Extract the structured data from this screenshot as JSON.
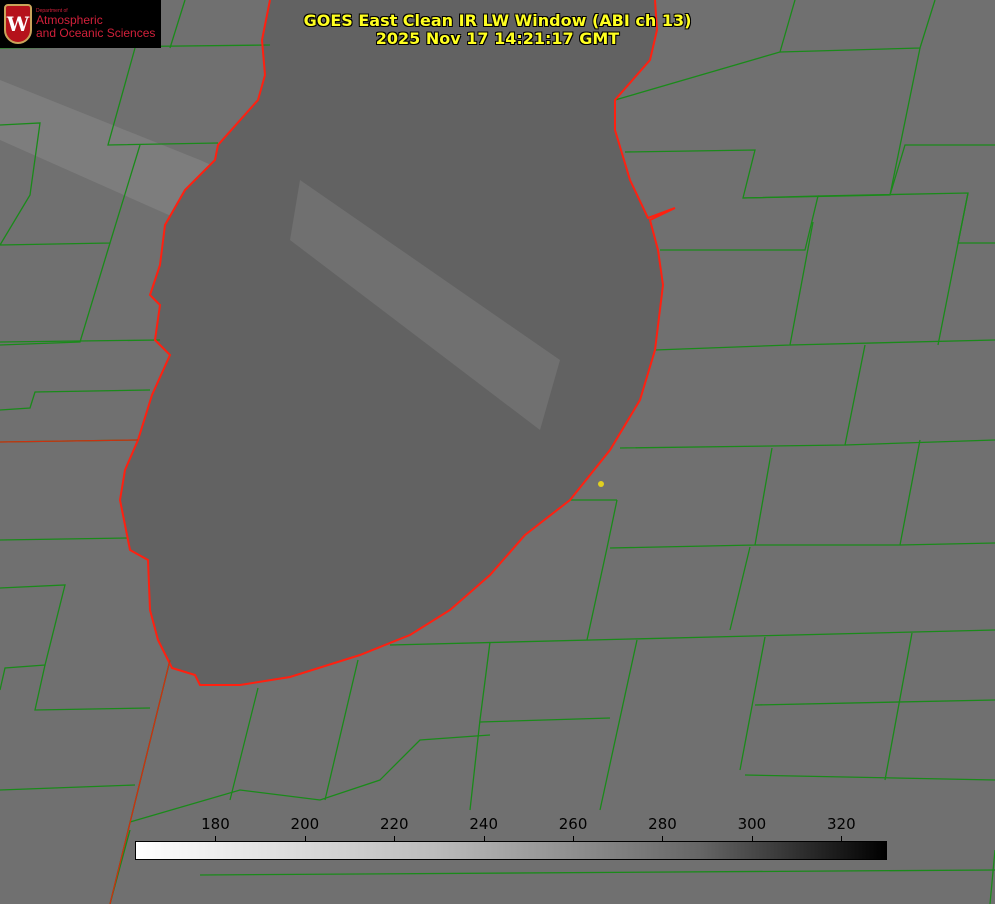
{
  "logo": {
    "dept": "Department of",
    "line1": "Atmospheric",
    "line2": "and Oceanic Sciences",
    "crest_letter": "W"
  },
  "title": {
    "line1": "GOES East Clean IR LW Window (ABI ch 13)",
    "line2": "2025 Nov 17 14:21:17 GMT"
  },
  "colorbar": {
    "min": 162,
    "max": 330,
    "ticks": [
      "180",
      "200",
      "220",
      "240",
      "260",
      "280",
      "300",
      "320"
    ],
    "tick_values": [
      180,
      200,
      220,
      240,
      260,
      280,
      300,
      320
    ]
  },
  "colors": {
    "title": "#ffff20",
    "county_lines": "#1a8a1a",
    "coastline": "#ff2010",
    "marker": "#e0d020"
  }
}
